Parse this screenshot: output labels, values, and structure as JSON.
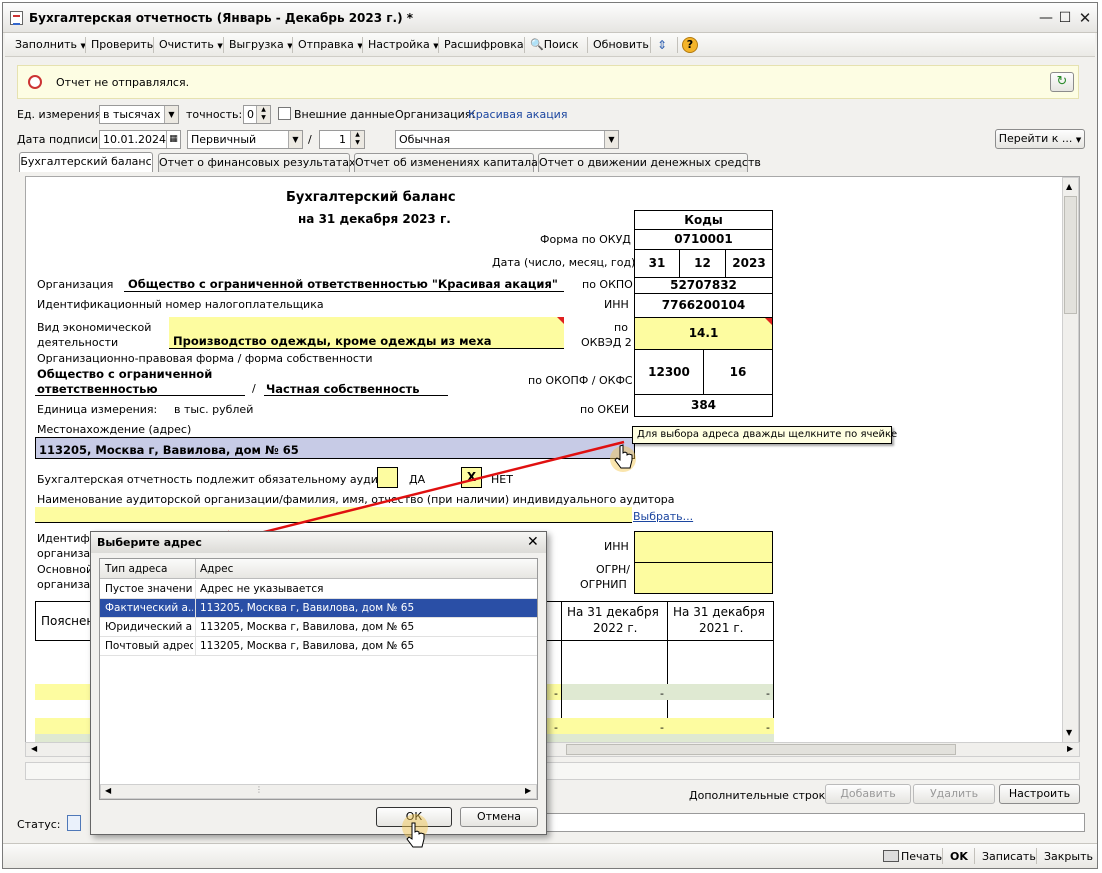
{
  "window": {
    "title": "Бухгалтерская отчетность (Январь - Декабрь 2023 г.) *"
  },
  "toolbar": {
    "fill": "Заполнить",
    "check": "Проверить",
    "clear": "Очистить",
    "export": "Выгрузка",
    "send": "Отправка",
    "settings": "Настройка",
    "decode": "Расшифровка",
    "search": "Поиск",
    "refresh": "Обновить",
    "help": "?"
  },
  "info": {
    "text": "Отчет не отправлялся."
  },
  "params": {
    "unit_label": "Ед. измерения:",
    "unit_value": "в тысячах р",
    "precision_label": "точность:",
    "precision_value": "0",
    "external_label": "Внешние данные",
    "org_label": "Организация:",
    "org_value": "Красивая акация",
    "sign_date_label": "Дата подписи:",
    "sign_date_value": "10.01.2024",
    "kind_value": "Первичный",
    "slash": "/",
    "num_value": "1",
    "mode_value": "Обычная",
    "goto_button": "Перейти к ..."
  },
  "tabs": [
    {
      "label": "Бухгалтерский баланс"
    },
    {
      "label": "Отчет о финансовых результатах"
    },
    {
      "label": "Отчет об изменениях капитала"
    },
    {
      "label": "Отчет о движении денежных средств"
    }
  ],
  "form": {
    "title": "Бухгалтерский баланс",
    "date_line": "на 31 декабря 2023 г.",
    "codes_header": "Коды",
    "okud_label": "Форма по ОКУД",
    "okud": "0710001",
    "date_label": "Дата (число, месяц, год)",
    "day": "31",
    "month": "12",
    "year": "2023",
    "org_label": "Организация",
    "org_name": "Общество с ограниченной ответственностью \"Красивая акация\"",
    "okpo_label": "по ОКПО",
    "okpo": "52707832",
    "inn_line_label": "Идентификационный номер налогоплательщика",
    "inn_label": "ИНН",
    "inn": "7766200104",
    "activity_label_1": "Вид экономической",
    "activity_label_2": "деятельности",
    "activity": "Производство одежды, кроме одежды из меха",
    "okved_label_1": "по",
    "okved_label_2": "ОКВЭД 2",
    "okved": "14.1",
    "legal_form_label": "Организационно-правовая форма / форма собственности",
    "legal_form_1": "Общество с ограниченной",
    "legal_form_2": "ответственностью",
    "legal_slash": "/",
    "ownership": "Частная собственность",
    "okopf_label": "по ОКОПФ / ОКФС",
    "okopf": "12300",
    "okfs": "16",
    "unit_label": "Единица измерения:",
    "unit": "в тыс. рублей",
    "okei_label": "по ОКЕИ",
    "okei": "384",
    "address_label": "Местонахождение (адрес)",
    "address": "113205, Москва г, Вавилова, дом № 65",
    "audit_label": "Бухгалтерская отчетность подлежит обязательному аудиту",
    "audit_yes": "ДА",
    "audit_no_mark": "X",
    "audit_no": "НЕТ",
    "auditor_label": "Наименование аудиторской организации/фамилия, имя, отчество (при наличии) индивидуального аудитора",
    "choose_link": "Выбрать...",
    "ident_1": "Идентиф",
    "ident_2": "организа",
    "basic_1": "Основной",
    "basic_2": "организа",
    "inn2_label": "ИНН",
    "ogrn_label_1": "ОГРН/",
    "ogrn_label_2": "ОГРНИП",
    "col_explain": "Пояснен",
    "col_2022_1": "На 31 декабря",
    "col_2022_2": "2022 г.",
    "col_2021_1": "На 31 декабря",
    "col_2021_2": "2021 г.",
    "dash": "-"
  },
  "tooltip": {
    "text": "Для выбора адреса дважды щелкните по ячейке"
  },
  "dialog": {
    "title": "Выберите адрес",
    "col_type": "Тип адреса",
    "col_address": "Адрес",
    "rows": [
      {
        "type": "Пустое значение",
        "address": "Адрес не указывается"
      },
      {
        "type": "Фактический а...",
        "address": "113205, Москва г, Вавилова, дом № 65"
      },
      {
        "type": "Юридический а...",
        "address": "113205, Москва г, Вавилова, дом № 65"
      },
      {
        "type": "Почтовый адрес",
        "address": "113205, Москва г, Вавилова, дом № 65"
      }
    ],
    "ok": "ОК",
    "cancel": "Отмена"
  },
  "footer": {
    "extra_rows_label": "Дополнительные строки:",
    "add": "Добавить",
    "delete": "Удалить",
    "configure": "Настроить",
    "status_label": "Статус:",
    "print": "Печать",
    "ok": "OK",
    "save": "Записать",
    "close": "Закрыть"
  },
  "colors": {
    "selection": "#2a4fa6",
    "yellow_field": "#fdfca0",
    "arrow": "#e01010"
  }
}
